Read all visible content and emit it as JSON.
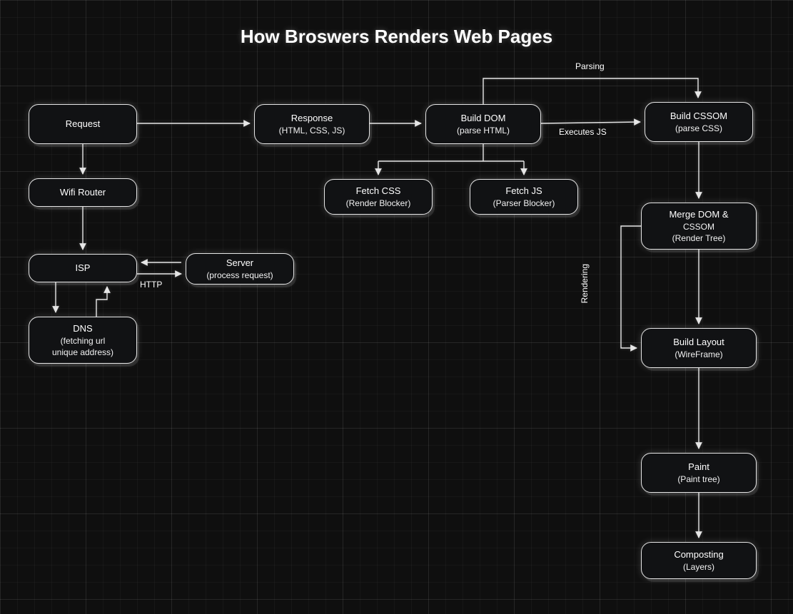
{
  "title": "How Broswers Renders Web Pages",
  "nodes": {
    "request": {
      "l1": "Request"
    },
    "wifi": {
      "l1": "Wifi Router"
    },
    "isp": {
      "l1": "ISP"
    },
    "dns": {
      "l1": "DNS",
      "l2": "(fetching url",
      "l3": "unique address)"
    },
    "server": {
      "l1": "Server",
      "l2": "(process request)"
    },
    "response": {
      "l1": "Response",
      "l2": "(HTML, CSS, JS)"
    },
    "buildDom": {
      "l1": "Build DOM",
      "l2": "(parse HTML)"
    },
    "fetchCss": {
      "l1": "Fetch CSS",
      "l2": "(Render Blocker)"
    },
    "fetchJs": {
      "l1": "Fetch JS",
      "l2": "(Parser Blocker)"
    },
    "buildCssom": {
      "l1": "Build CSSOM",
      "l2": "(parse CSS)"
    },
    "merge": {
      "l1": "Merge DOM &",
      "l2": "CSSOM",
      "l3": "(Render Tree)"
    },
    "layout": {
      "l1": "Build Layout",
      "l2": "(WireFrame)"
    },
    "paint": {
      "l1": "Paint",
      "l2": "(Paint tree)"
    },
    "composite": {
      "l1": "Composting",
      "l2": "(Layers)"
    }
  },
  "edgeLabels": {
    "parsing": "Parsing",
    "executesJs": "Executes JS",
    "http": "HTTP",
    "rendering": "Rendering"
  }
}
